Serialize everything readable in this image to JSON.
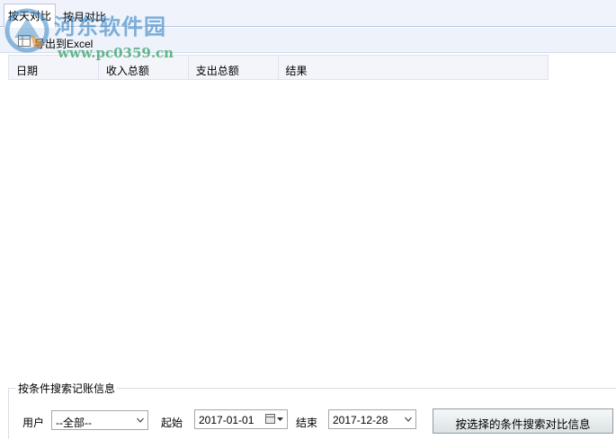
{
  "tabs": [
    {
      "label": "按天对比",
      "active": true
    },
    {
      "label": "按月对比",
      "active": false
    }
  ],
  "watermark": {
    "site_name": "河东软件园",
    "url": "www.pc0359.cn"
  },
  "toolbar": {
    "export_label": "导出到Excel",
    "export_icon": "excel-export-icon"
  },
  "grid": {
    "columns": [
      "日期",
      "收入总额",
      "支出总额",
      "结果"
    ],
    "rows": []
  },
  "search": {
    "group_title": "按条件搜索记账信息",
    "user_label": "用户",
    "user_value": "--全部--",
    "start_label": "起始",
    "start_value": "2017-01-01",
    "end_label": "结束",
    "end_value": "2017-12-28",
    "search_button_label": "按选择的条件搜索对比信息"
  },
  "colors": {
    "tab_border": "#b9c6e0",
    "header_bg": "#f3f5fa",
    "watermark_blue": "#3684c4",
    "watermark_green": "#289a5c"
  }
}
